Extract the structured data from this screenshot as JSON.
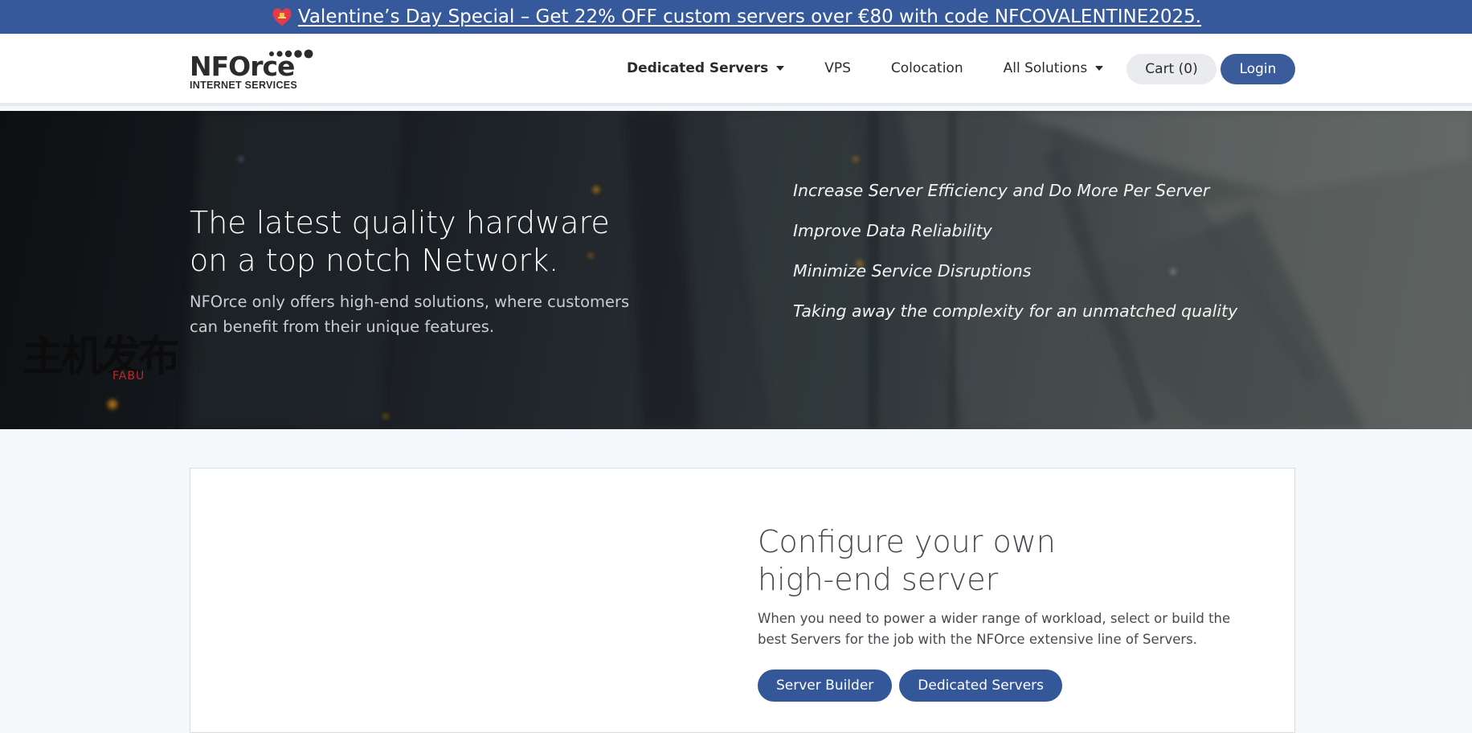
{
  "promo": {
    "icon": "heart-gift-icon",
    "text": "Valentine’s Day Special – Get 22% OFF custom servers over €80 with code NFCOVALENTINE2025."
  },
  "header": {
    "logo": {
      "wordmark": "NFOrce",
      "subtitle": "INTERNET SERVICES"
    },
    "nav": [
      {
        "label": "Dedicated Servers",
        "dropdown": true,
        "active": true
      },
      {
        "label": "VPS",
        "dropdown": false
      },
      {
        "label": "Colocation",
        "dropdown": false
      },
      {
        "label": "All Solutions",
        "dropdown": true
      }
    ],
    "cart_label": "Cart (0)",
    "login_label": "Login"
  },
  "hero": {
    "title_line1": "The latest quality hardware",
    "title_line2": "on a top notch Network.",
    "description": "NFOrce only offers high-end solutions, where customers can benefit from their unique features.",
    "features": [
      "Increase Server Efficiency and Do More Per Server",
      "Improve Data Reliability",
      "Minimize Service Disruptions",
      "Taking away the complexity for an unmatched quality"
    ],
    "watermark": {
      "cn": "主机发布",
      "en": "FABU"
    }
  },
  "configure": {
    "title_line1": "Configure your own",
    "title_line2": "high-end server",
    "description": "When you need to power a wider range of workload, select or build the best Servers for the job with the NFOrce extensive line of Servers.",
    "buttons": [
      "Server Builder",
      "Dedicated Servers"
    ]
  },
  "colors": {
    "brand_blue": "#35599a",
    "button_blue": "#345799",
    "login_blue": "#3c5b9b",
    "page_bg": "#f4f8fb"
  }
}
